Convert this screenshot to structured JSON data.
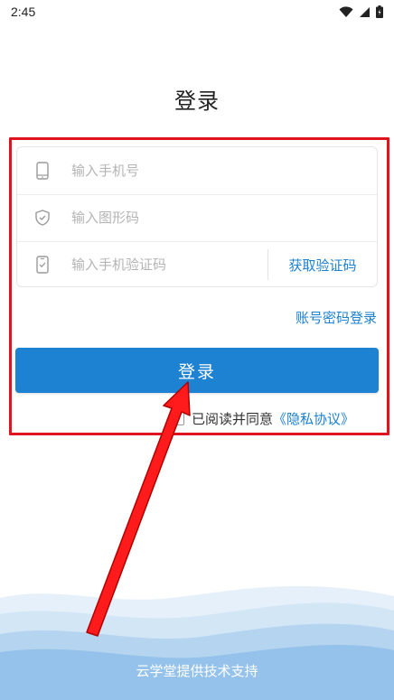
{
  "status_bar": {
    "time": "2:45"
  },
  "page": {
    "title": "登录"
  },
  "form": {
    "phone": {
      "placeholder": "输入手机号",
      "value": ""
    },
    "captcha": {
      "placeholder": "输入图形码",
      "value": ""
    },
    "sms_code": {
      "placeholder": "输入手机验证码",
      "value": ""
    },
    "get_code_label": "获取验证码"
  },
  "account_login_label": "账号密码登录",
  "login_button_label": "登录",
  "agreement": {
    "text": "已阅读并同意",
    "link": "《隐私协议》",
    "checked": false
  },
  "footer": {
    "text": "云学堂提供技术支持"
  },
  "colors": {
    "accent": "#1e82d2",
    "link": "#1d80d0",
    "highlight": "#e0141e"
  },
  "icons": [
    "phone-icon",
    "shield-icon",
    "sms-phone-icon",
    "wifi-icon",
    "signal-icon",
    "battery-icon"
  ]
}
